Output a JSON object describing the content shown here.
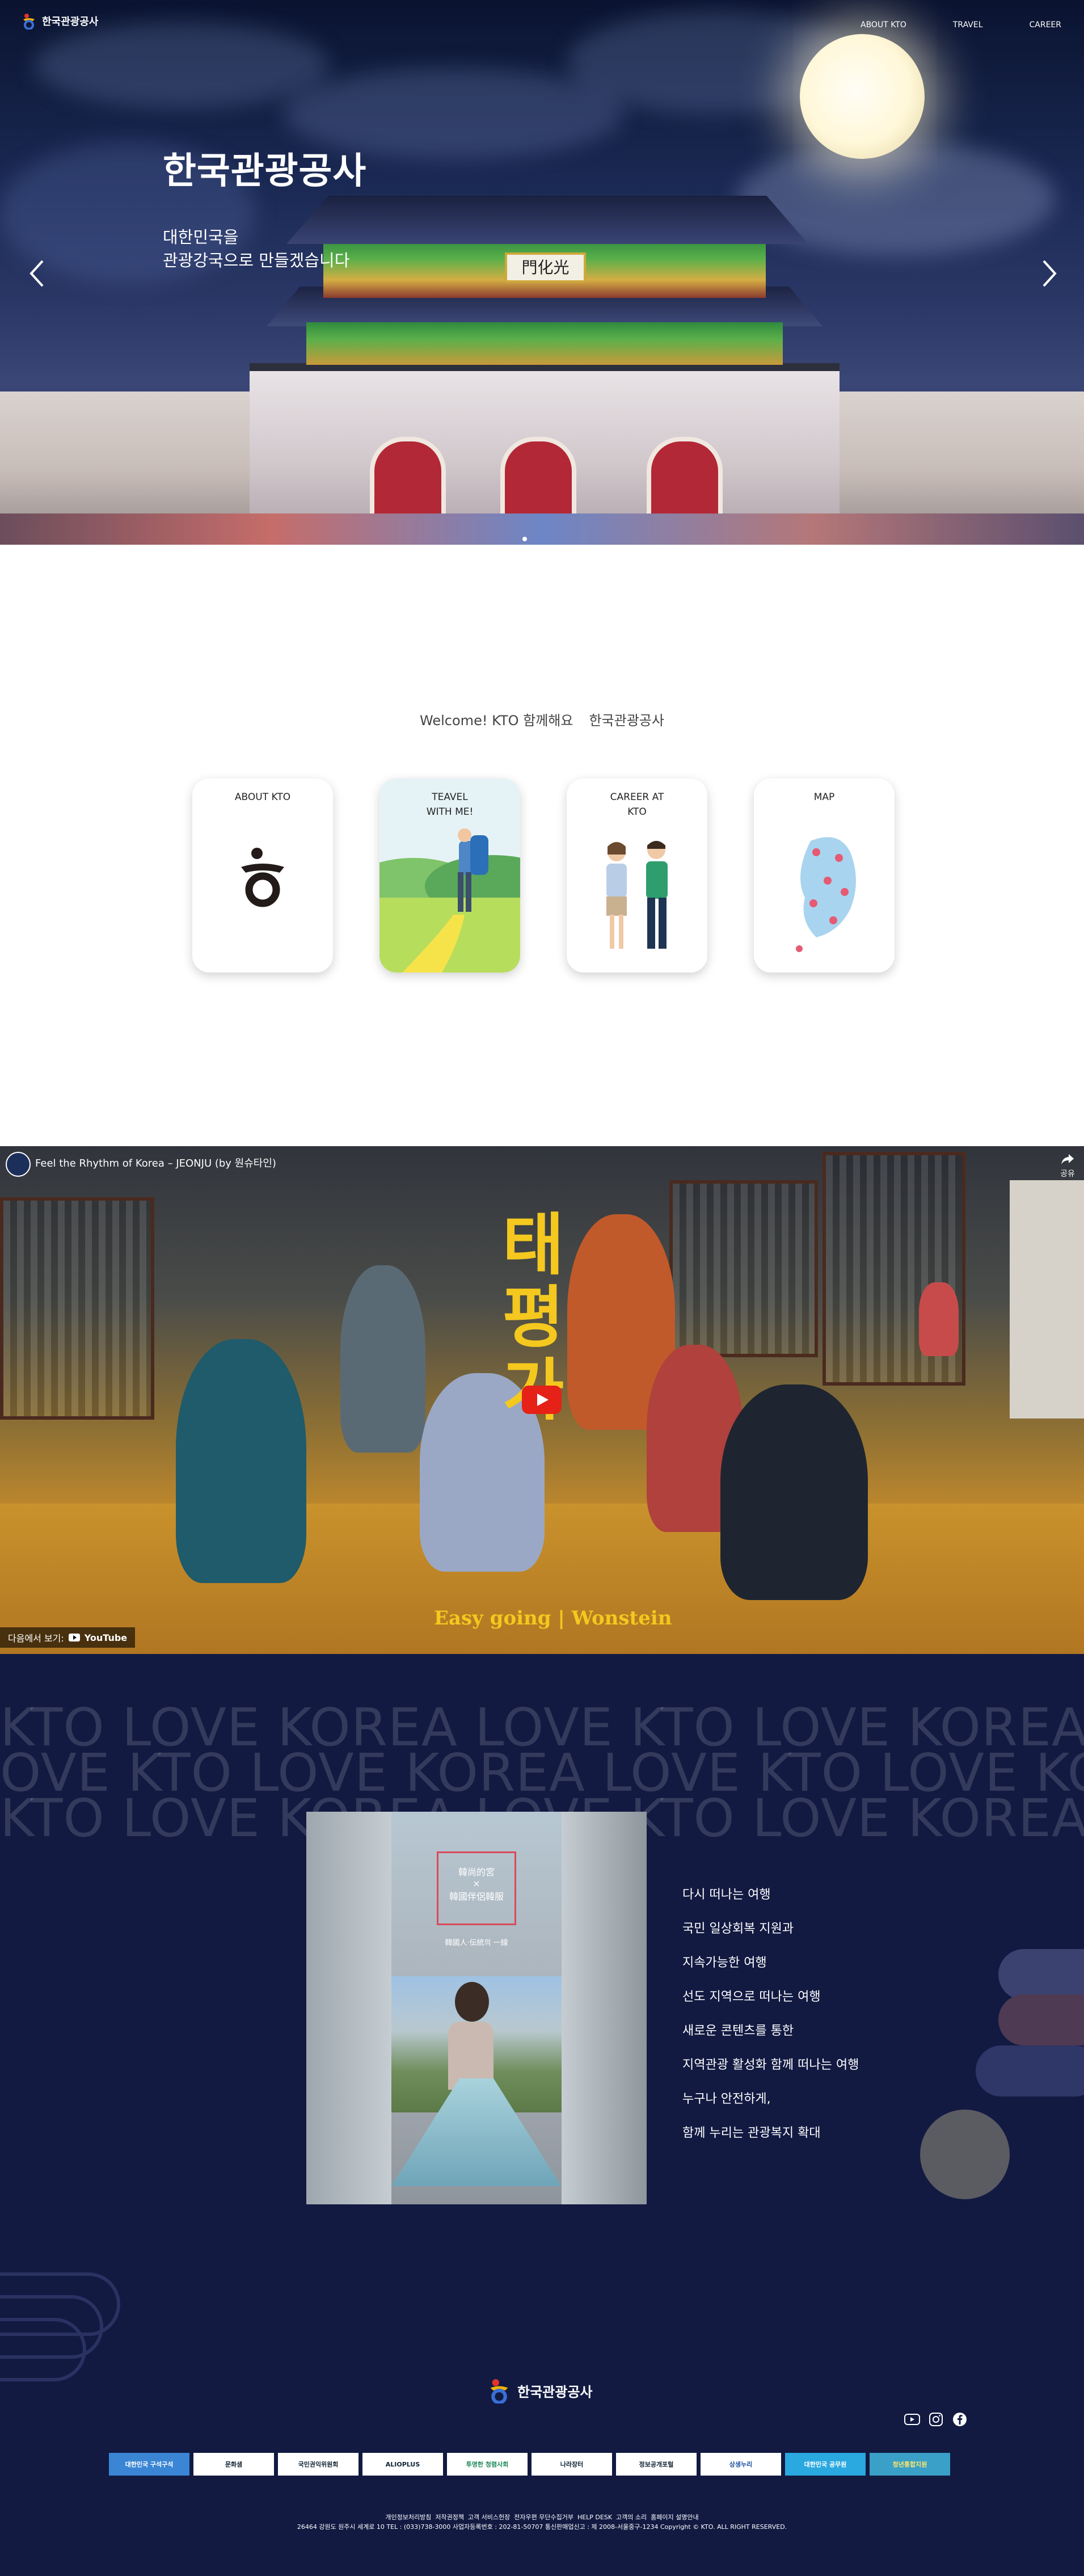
{
  "nav": {
    "logo_text": "한국관광공사",
    "links": [
      "ABOUT KTO",
      "TRAVEL",
      "CAREER"
    ]
  },
  "hero": {
    "title": "한국관광공사",
    "subtitle": "대한민국을\n관광강국으로 만들겠습니다",
    "gate_sign": "門化光"
  },
  "welcome": {
    "prefix": "Welcome! KTO 함께해요",
    "brand": "한국관광공사"
  },
  "cards": [
    {
      "label": "ABOUT KTO"
    },
    {
      "label": "TEAVEL\nWITH ME!"
    },
    {
      "label": "CAREER AT\nKTO"
    },
    {
      "label": "MAP"
    }
  ],
  "video": {
    "title": "Feel the Rhythm of Korea – JEONJU (by 원슈타인)",
    "title_text": "태평가",
    "caption": "Easy going | Wonstein",
    "watch_on": "다음에서 보기:",
    "youtube": "YouTube",
    "share": "공유"
  },
  "love": {
    "marquee": [
      "KTO LOVE KOREA LOVE KTO LOVE KOREA",
      "OVE KTO LOVE KOREA LOVE KTO LOVE KO",
      "KTO LOVE KOREA LOVE KTO LOVE KOREA"
    ],
    "photo_sign": "韓尚的宮\n×\n韓國伴侶韓服",
    "photo_sub": "韓國人·伝統의 一線",
    "poem": [
      "다시 떠나는 여행",
      "국민 일상회복 지원과",
      "지속가능한 여행",
      "선도 지역으로 떠나는 여행",
      "새로운 콘텐츠를 통한",
      "지역관광 활성화 함께 떠나는 여행",
      "누구나 안전하게,",
      "함께 누리는 관광복지 확대"
    ]
  },
  "footer": {
    "logo_text": "한국관광공사",
    "social": [
      "youtube-icon",
      "instagram-icon",
      "facebook-icon"
    ],
    "banners": [
      "대한민국 구석구석",
      "문화샘",
      "국민권익위원회",
      "ALIOPLUS",
      "투명한 청렴사회",
      "나라장터",
      "정보공개포털",
      "상생누리",
      "대한민국 공무원",
      "청년통합지원"
    ],
    "lines": [
      "개인정보처리방침  저작권정책  고객 서비스헌장  전자우편 무단수집거부  HELP DESK  고객의 소리  홈페이지 설명안내",
      "26464 강원도 원주시 세계로 10 TEL : (033)738-3000 사업자등록번호 : 202-81-50707 통신판매업신고 : 제 2008-서울중구-1234 Copyright © KTO. ALL RIGHT RESERVED."
    ]
  },
  "colors": {
    "footer_bg": "#121a42",
    "play_red": "#e62117",
    "caption_yellow": "#f4c81e"
  }
}
